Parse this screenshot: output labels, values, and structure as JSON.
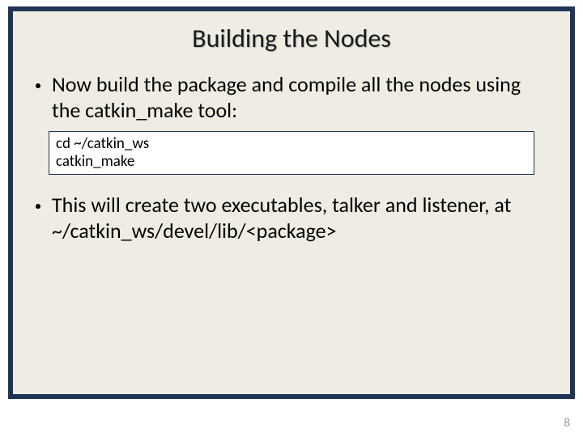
{
  "slide": {
    "title": "Building the Nodes",
    "bullets": [
      "Now build the package and compile all the nodes using the catkin_make tool:",
      "This will create two executables, talker and listener, at ~/catkin_ws/devel/lib/<package>"
    ],
    "code": {
      "lines": [
        "cd ~/catkin_ws",
        "catkin_make"
      ]
    },
    "page_number": "8"
  }
}
